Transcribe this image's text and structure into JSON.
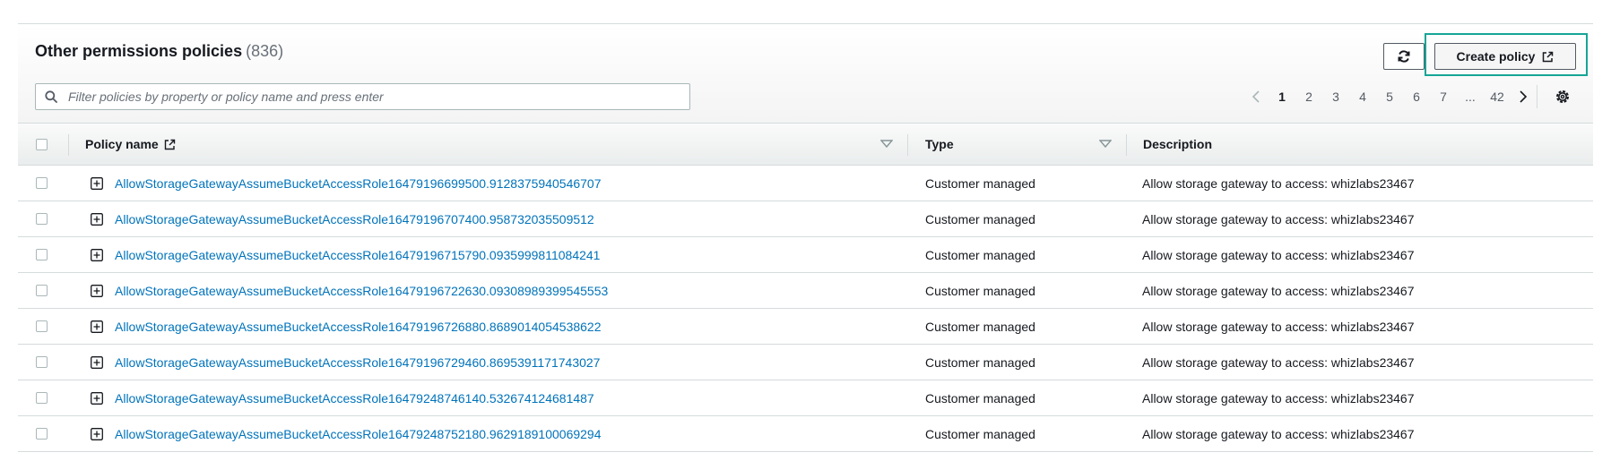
{
  "panel": {
    "title": "Other permissions policies",
    "count": "(836)"
  },
  "actions": {
    "create_label": "Create policy"
  },
  "filter": {
    "placeholder": "Filter policies by property or policy name and press enter"
  },
  "pagination": {
    "pages": [
      "1",
      "2",
      "3",
      "4",
      "5",
      "6",
      "7",
      "...",
      "42"
    ],
    "current": "1"
  },
  "columns": {
    "policy_name": "Policy name",
    "type": "Type",
    "description": "Description"
  },
  "rows": [
    {
      "name": "AllowStorageGatewayAssumeBucketAccessRole16479196699500.9128375940546707",
      "type": "Customer managed",
      "description": "Allow storage gateway to access: whizlabs23467"
    },
    {
      "name": "AllowStorageGatewayAssumeBucketAccessRole16479196707400.958732035509512",
      "type": "Customer managed",
      "description": "Allow storage gateway to access: whizlabs23467"
    },
    {
      "name": "AllowStorageGatewayAssumeBucketAccessRole16479196715790.0935999811084241",
      "type": "Customer managed",
      "description": "Allow storage gateway to access: whizlabs23467"
    },
    {
      "name": "AllowStorageGatewayAssumeBucketAccessRole16479196722630.09308989399545553",
      "type": "Customer managed",
      "description": "Allow storage gateway to access: whizlabs23467"
    },
    {
      "name": "AllowStorageGatewayAssumeBucketAccessRole16479196726880.8689014054538622",
      "type": "Customer managed",
      "description": "Allow storage gateway to access: whizlabs23467"
    },
    {
      "name": "AllowStorageGatewayAssumeBucketAccessRole16479196729460.8695391171743027",
      "type": "Customer managed",
      "description": "Allow storage gateway to access: whizlabs23467"
    },
    {
      "name": "AllowStorageGatewayAssumeBucketAccessRole16479248746140.532674124681487",
      "type": "Customer managed",
      "description": "Allow storage gateway to access: whizlabs23467"
    },
    {
      "name": "AllowStorageGatewayAssumeBucketAccessRole16479248752180.9629189100069294",
      "type": "Customer managed",
      "description": "Allow storage gateway to access: whizlabs23467"
    }
  ],
  "colors": {
    "link": "#0073bb",
    "highlight": "#16a596"
  }
}
